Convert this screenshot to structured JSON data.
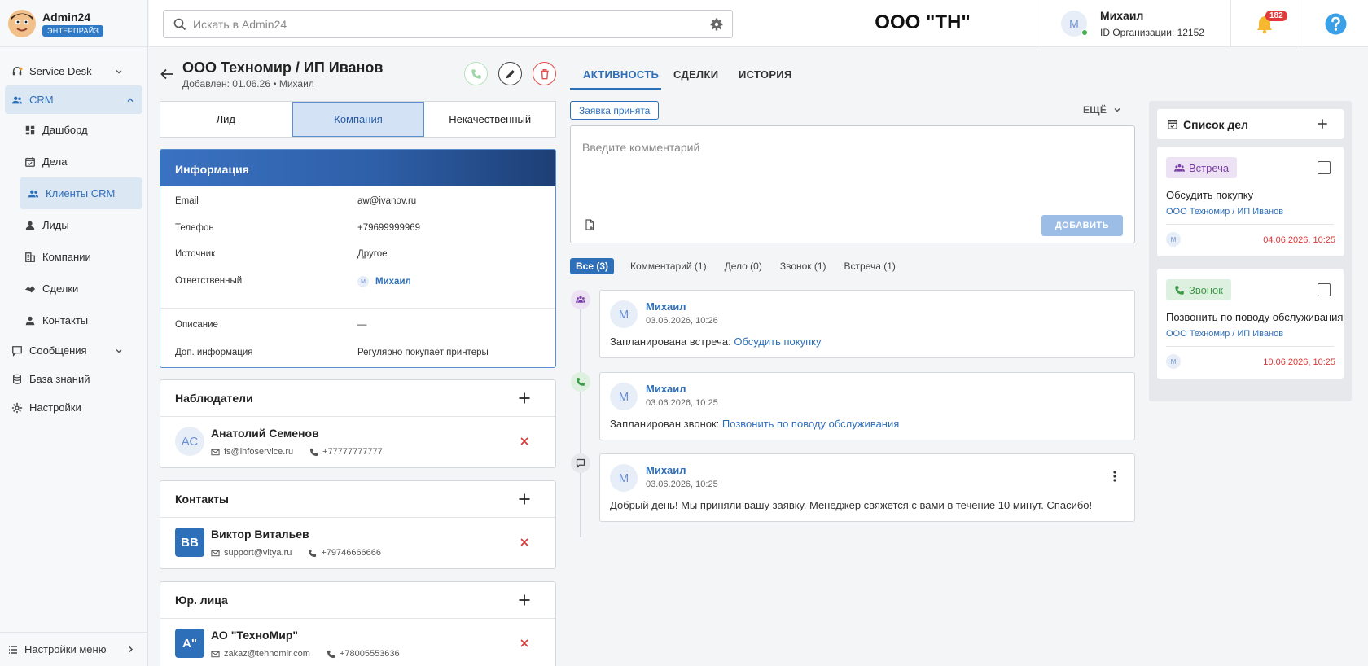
{
  "brand": {
    "name": "Admin24",
    "plan": "ЭНТЕРПРАЙЗ"
  },
  "sidebar": {
    "items": [
      {
        "label": "Service Desk"
      },
      {
        "label": "CRM"
      },
      {
        "label": "Дашборд"
      },
      {
        "label": "Дела"
      },
      {
        "label": "Клиенты CRM"
      },
      {
        "label": "Лиды"
      },
      {
        "label": "Компании"
      },
      {
        "label": "Сделки"
      },
      {
        "label": "Контакты"
      },
      {
        "label": "Сообщения"
      },
      {
        "label": "База знаний"
      },
      {
        "label": "Настройки"
      }
    ],
    "bottom": "Настройки меню"
  },
  "header": {
    "search_placeholder": "Искать в Admin24",
    "org_title": "ООО \"ТН\"",
    "user_initial": "М",
    "user_name": "Михаил",
    "org_id": "ID Организации: 12152",
    "notifications": "182"
  },
  "record": {
    "title": "ООО Техномир / ИП Иванов",
    "subtitle": "Добавлен: 01.06.26 • Михаил"
  },
  "stages": [
    "Лид",
    "Компания",
    "Некачественный"
  ],
  "info": {
    "title": "Информация",
    "email_label": "Email",
    "email": "aw@ivanov.ru",
    "phone_label": "Телефон",
    "phone": "+79699999969",
    "source_label": "Источник",
    "source": "Другое",
    "owner_label": "Ответственный",
    "owner_initial": "М",
    "owner": "Михаил",
    "desc_label": "Описание",
    "desc": "—",
    "extra_label": "Доп. информация",
    "extra": "Регулярно покупает принтеры"
  },
  "observers": {
    "title": "Наблюдатели",
    "initials": "АС",
    "name": "Анатолий Семенов",
    "email": "fs@infoservice.ru",
    "phone": "+77777777777"
  },
  "contacts": {
    "title": "Контакты",
    "initials": "ВВ",
    "name": "Виктор Витальев",
    "email": "support@vitya.ru",
    "phone": "+79746666666"
  },
  "legal": {
    "title": "Юр. лица",
    "initials": "А\"",
    "name": "АО \"ТехноМир\"",
    "email": "zakaz@tehnomir.com",
    "phone": "+78005553636"
  },
  "tabs": [
    "АКТИВНОСТЬ",
    "СДЕЛКИ",
    "ИСТОРИЯ"
  ],
  "status_chip": "Заявка принята",
  "more_label": "ЕЩЁ",
  "comment": {
    "placeholder": "Введите комментарий",
    "add": "ДОБАВИТЬ"
  },
  "filters": [
    "Все (3)",
    "Комментарий (1)",
    "Дело (0)",
    "Звонок (1)",
    "Встреча (1)"
  ],
  "events": [
    {
      "initial": "М",
      "author": "Михаил",
      "date": "03.06.2026, 10:26",
      "text": "Запланирована встреча: ",
      "link": "Обсудить покупку"
    },
    {
      "initial": "М",
      "author": "Михаил",
      "date": "03.06.2026, 10:25",
      "text": "Запланирован звонок: ",
      "link": "Позвонить по поводу обслуживания"
    },
    {
      "initial": "М",
      "author": "Михаил",
      "date": "03.06.2026, 10:25",
      "text": "Добрый день! Мы приняли вашу заявку. Менеджер свяжется с вами в течение 10 минут. Спасибо!"
    }
  ],
  "todo": {
    "title": "Список дел",
    "tasks": [
      {
        "tag": "Встреча",
        "title": "Обсудить покупку",
        "client": "ООО Техномир / ИП Иванов",
        "initial": "М",
        "due": "04.06.2026, 10:25"
      },
      {
        "tag": "Звонок",
        "title": "Позвонить по поводу обслуживания",
        "client": "ООО Техномир / ИП Иванов",
        "initial": "М",
        "due": "10.06.2026, 10:25"
      }
    ]
  },
  "colors": {
    "accent": "#2e6fba",
    "danger": "#d93636",
    "success": "#43b14b",
    "meeting": "#7a3fa5"
  }
}
